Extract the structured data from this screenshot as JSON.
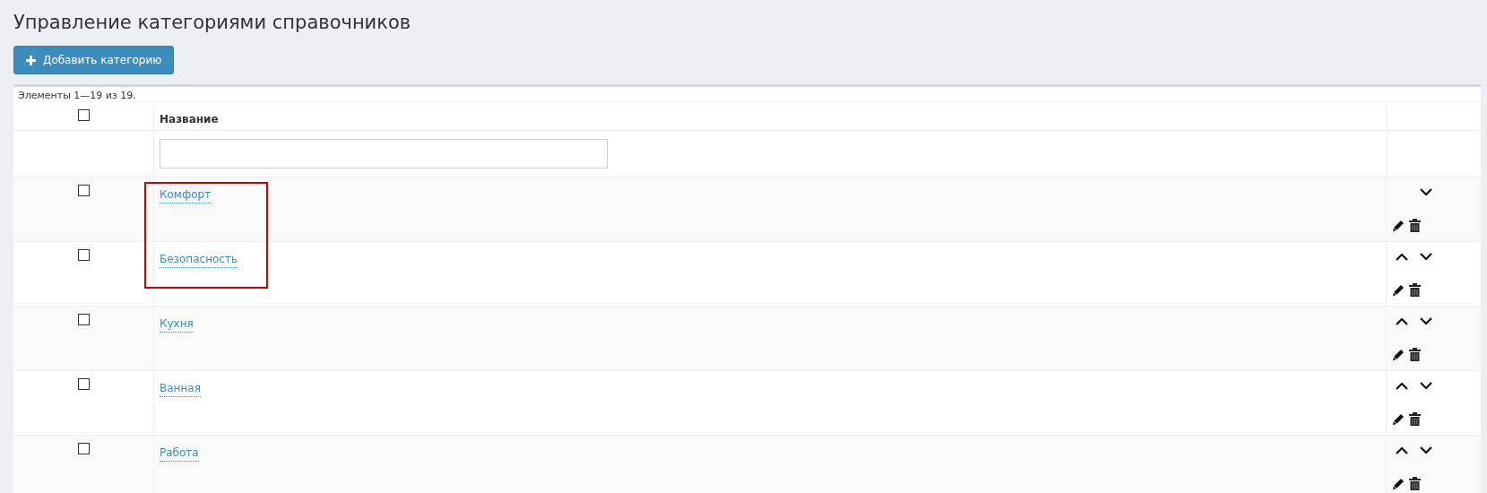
{
  "page": {
    "title": "Управление категориями справочников"
  },
  "add_button": {
    "label": "Добавить категорию"
  },
  "grid": {
    "summary": "Элементы 1—19 из 19.",
    "select_all": {
      "checked": false
    },
    "columns": [
      "Название"
    ],
    "rows": [
      {
        "name": "Комфорт",
        "checked": false,
        "can_move_up": false,
        "can_move_down": true,
        "highlighted": true
      },
      {
        "name": "Безопасность",
        "checked": false,
        "can_move_up": true,
        "can_move_down": true,
        "highlighted": true
      },
      {
        "name": "Кухня",
        "checked": false,
        "can_move_up": true,
        "can_move_down": true,
        "highlighted": false
      },
      {
        "name": "Ванная",
        "checked": false,
        "can_move_up": true,
        "can_move_down": true,
        "highlighted": false
      },
      {
        "name": "Работа",
        "checked": false,
        "can_move_up": true,
        "can_move_down": true,
        "highlighted": false
      }
    ]
  }
}
